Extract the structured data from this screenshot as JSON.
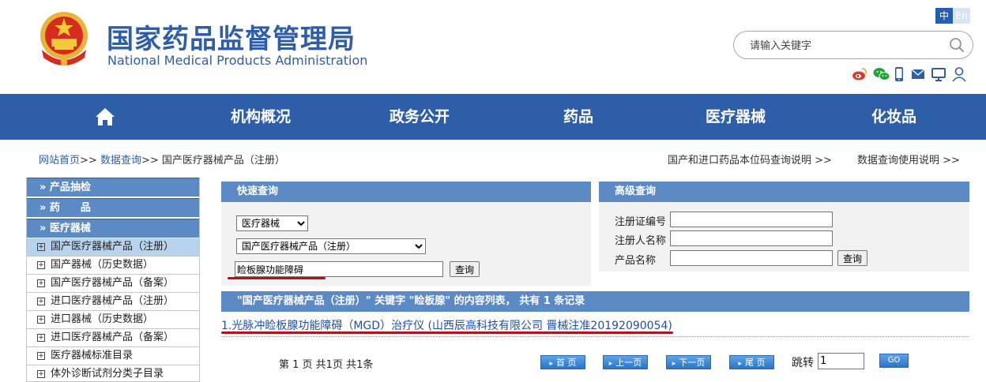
{
  "header": {
    "title_cn": "国家药品监督管理局",
    "title_en": "National Medical Products Administration",
    "lang_zh": "中",
    "lang_en": "En",
    "search_placeholder": "请输入关键字"
  },
  "nav": {
    "items": [
      "机构概况",
      "政务公开",
      "药品",
      "医疗器械",
      "化妆品"
    ]
  },
  "breadcrumb": {
    "home": "网站首页",
    "sep": ">>",
    "query": "数据查询",
    "current": "国产医疗器械产品（注册）",
    "right_link_1": "国产和进口药品本位码查询说明 >>",
    "right_link_2": "数据查询使用说明 >>"
  },
  "sidebar": {
    "heads": [
      "» 产品抽检",
      "» 药　　品",
      "» 医疗器械"
    ],
    "items": [
      "国产医疗器械产品（注册）",
      "国产器械（历史数据）",
      "国产医疗器械产品（备案）",
      "进口医疗器械产品（注册）",
      "进口器械（历史数据）",
      "进口医疗器械产品（备案）",
      "医疗器械标准目录",
      "体外诊断试剂分类子目录"
    ]
  },
  "quick": {
    "title": "快速查询",
    "category": "医疗器械",
    "subcategory": "国产医疗器械产品（注册）",
    "keyword": "睑板腺功能障碍",
    "button": "查询"
  },
  "advanced": {
    "title": "高级查询",
    "label_reg_no": "注册证编号",
    "label_registrant": "注册人名称",
    "label_product": "产品名称",
    "button": "查询"
  },
  "results": {
    "summary": "\"国产医疗器械产品（注册）\" 关键字 \"睑板腺\" 的内容列表， 共有 1 条记录",
    "items": [
      "1.光脉冲睑板腺功能障碍（MGD）治疗仪 (山西辰高科技有限公司 晋械注准20192090054)"
    ]
  },
  "pager": {
    "status": "第 1 页 共1页 共1条",
    "first": "首 页",
    "prev": "上一页",
    "next": "下一页",
    "last": "尾 页",
    "jump_label": "跳转",
    "jump_value": "1",
    "go": "GO"
  },
  "colors": {
    "brand_blue": "#2e5ea8",
    "panel_blue": "#5b8ac5",
    "highlight_red": "#b1141a"
  }
}
